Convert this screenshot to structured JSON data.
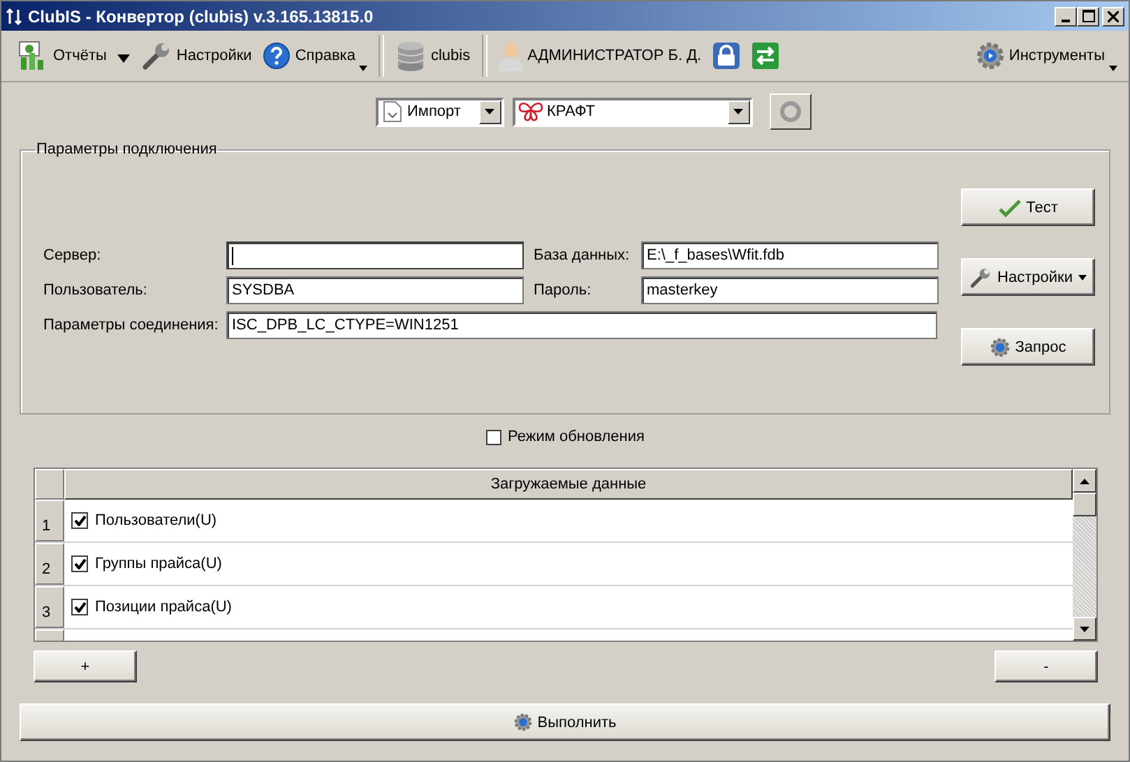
{
  "window": {
    "title": "ClubIS - Конвертор (clubis) v.3.165.13815.0"
  },
  "toolbar": {
    "items": [
      {
        "kind": "button",
        "label": "Отчёты",
        "dropdown": false
      },
      {
        "kind": "arrow"
      },
      {
        "kind": "button",
        "label": "Настройки",
        "dropdown": false
      },
      {
        "kind": "button",
        "label": "Справка",
        "dropdown": true
      },
      {
        "kind": "separator"
      },
      {
        "kind": "button",
        "label": "clubis",
        "dropdown": false
      },
      {
        "kind": "separator"
      },
      {
        "kind": "button",
        "label": "АДМИНИСТРАТОР Б. Д.",
        "dropdown": false
      },
      {
        "kind": "button",
        "dropdown": false
      },
      {
        "kind": "button",
        "dropdown": false
      },
      {
        "kind": "spacer"
      },
      {
        "kind": "button",
        "label": "Инструменты",
        "dropdown": true
      }
    ]
  },
  "mode_select": {
    "value": "Импорт"
  },
  "profile_select": {
    "value": "КРАФТ"
  },
  "profile_action": {
    "disabled": true
  },
  "connection": {
    "title": "Параметры подключения",
    "rows": [
      [
        {
          "label": "Сервер:",
          "focused": true
        },
        {
          "label": "База данных:",
          "value": "E:\\_f_bases\\Wfit.fdb",
          "focused": false
        }
      ],
      [
        {
          "label": "Пользователь:",
          "value": "SYSDBA",
          "focused": false
        },
        {
          "label": "Пароль:",
          "value": "masterkey",
          "focused": false
        }
      ],
      [
        {
          "label": "Параметры соединения:",
          "value": "ISC_DPB_LC_CTYPE=WIN1251",
          "focused": false
        }
      ]
    ],
    "buttons": [
      {
        "label": "Тест",
        "dropdown": false
      },
      {
        "label": "Настройки",
        "dropdown": true
      },
      {
        "label": "Запрос",
        "dropdown": false
      }
    ]
  },
  "update_mode": {
    "label": "Режим обновления",
    "checked": false
  },
  "grid": {
    "column": "Загружаемые данные",
    "rows": [
      {
        "number": "1",
        "label": "Пользователи(U)",
        "checked": true
      },
      {
        "number": "2",
        "label": "Группы прайса(U)",
        "checked": true
      },
      {
        "number": "3",
        "label": "Позиции прайса(U)",
        "checked": true
      }
    ]
  },
  "add_button": "+",
  "remove_button": "-",
  "execute_button": "Выполнить"
}
